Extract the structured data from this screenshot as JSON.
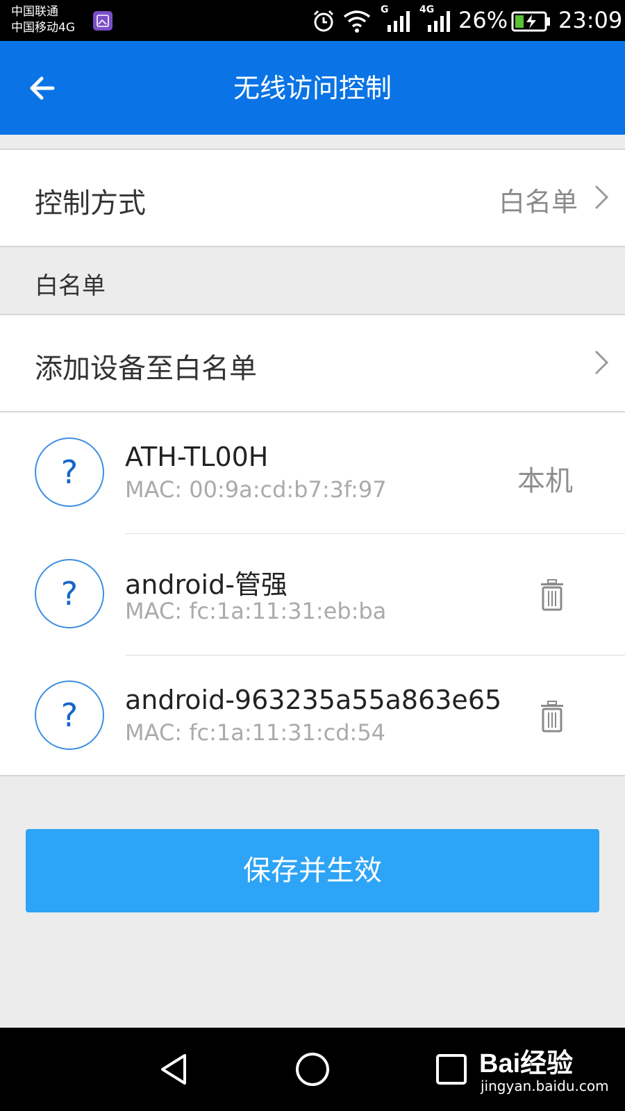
{
  "status_bar": {
    "carrier_1": "中国联通",
    "carrier_2": "中国移动4G",
    "net_g_label": "G",
    "net_4g_label": "4G",
    "battery_percent": "26%",
    "time": "23:09",
    "icons": [
      "gallery-notification-icon",
      "alarm-icon",
      "wifi-icon",
      "signal-icon",
      "signal-4g-icon",
      "battery-charging-icon"
    ]
  },
  "app_bar": {
    "title": "无线访问控制",
    "back_icon": "arrow-left-icon"
  },
  "control_mode": {
    "label": "控制方式",
    "value": "白名单"
  },
  "whitelist_section": {
    "header": "白名单",
    "add_label": "添加设备至白名单"
  },
  "devices": [
    {
      "name": "ATH-TL00H",
      "mac": "MAC: 00:9a:cd:b7:3f:97",
      "badge": "本机",
      "icon": "?"
    },
    {
      "name": "android-管强",
      "mac": "MAC: fc:1a:11:31:eb:ba",
      "action": "delete",
      "icon": "?"
    },
    {
      "name": "android-963235a55a863e65",
      "mac": "MAC: fc:1a:11:31:cd:54",
      "action": "delete",
      "icon": "?"
    }
  ],
  "save_button": {
    "label": "保存并生效"
  },
  "nav_bar": {
    "buttons": [
      "back-triangle-icon",
      "home-circle-icon",
      "recents-square-icon"
    ]
  },
  "watermark": {
    "brand": "Bai经验",
    "url": "jingyan.baidu.com"
  },
  "colors": {
    "app_bar": "#0a73e5",
    "save_button": "#2da4f5",
    "icon_border": "#3c8fe2"
  }
}
